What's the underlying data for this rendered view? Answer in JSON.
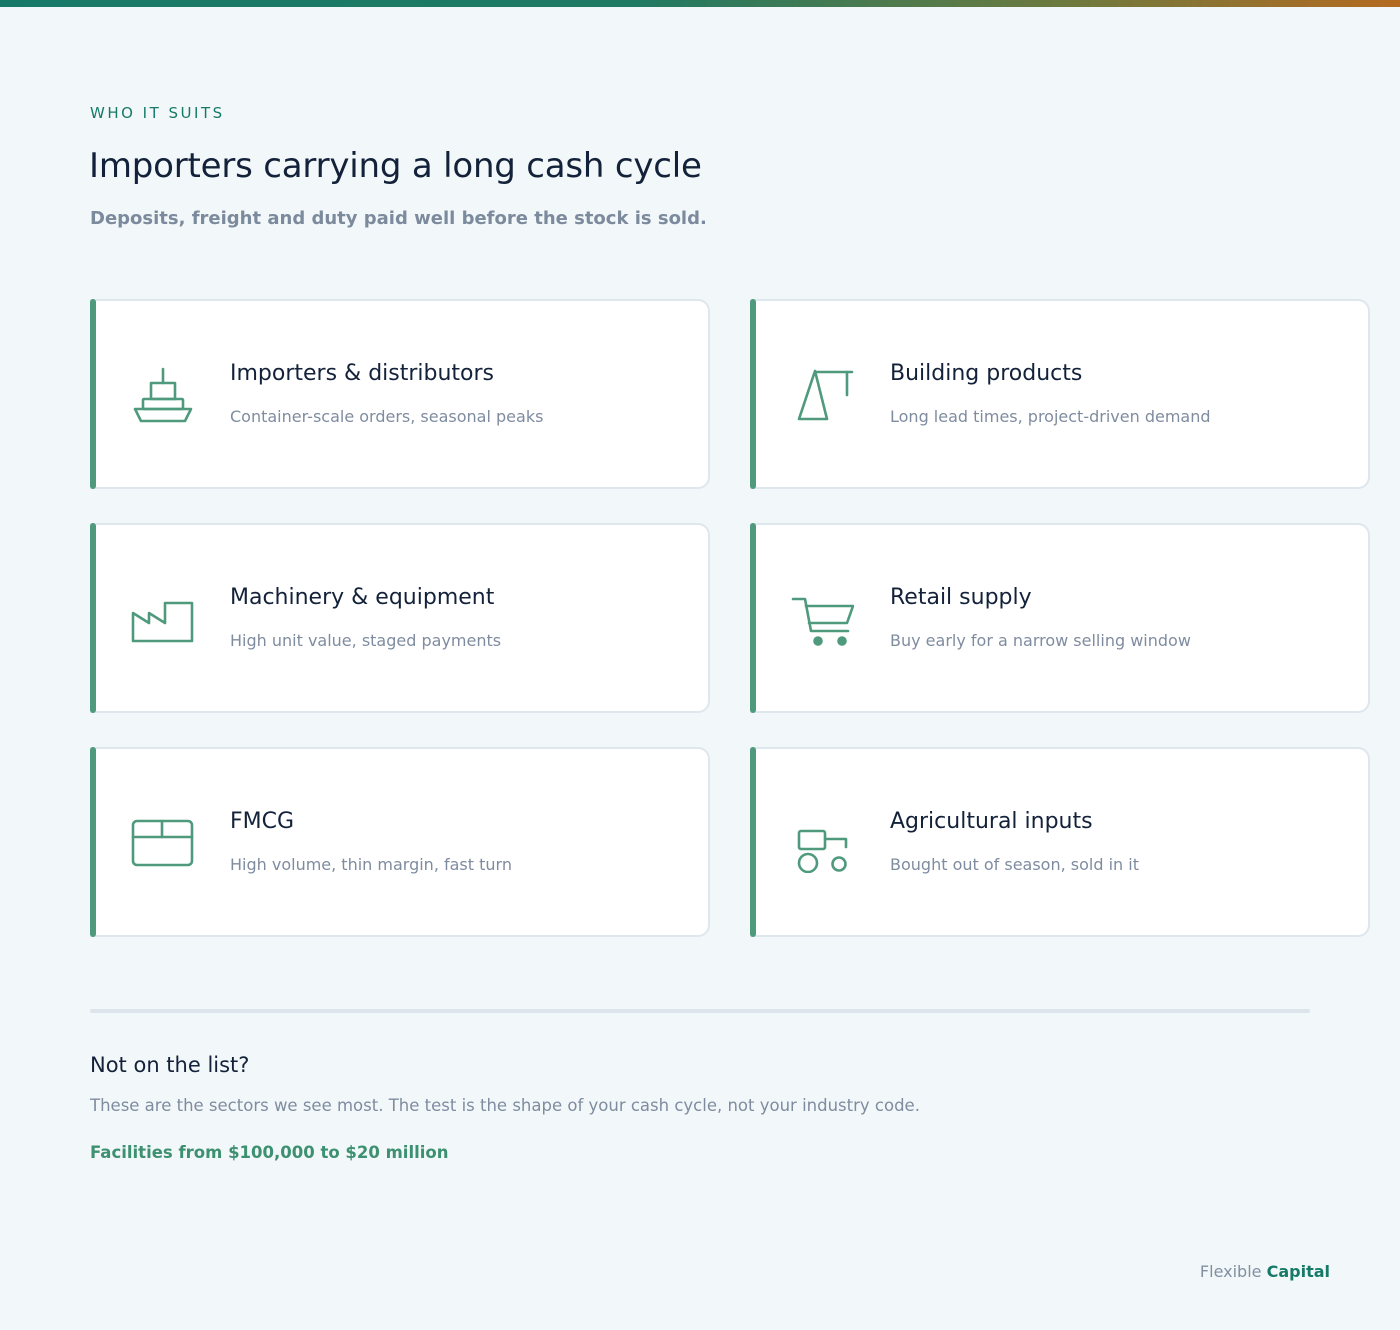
{
  "header": {
    "eyebrow": "WHO IT SUITS",
    "title": "Importers carrying a long cash cycle",
    "subtitle": "Deposits, freight and duty paid well before the stock is sold."
  },
  "sectors": [
    {
      "icon": "ship-icon",
      "title": "Importers & distributors",
      "desc": "Container-scale orders, seasonal peaks"
    },
    {
      "icon": "crane-icon",
      "title": "Building products",
      "desc": "Long lead times, project-driven demand"
    },
    {
      "icon": "factory-icon",
      "title": "Machinery & equipment",
      "desc": "High unit value, staged payments"
    },
    {
      "icon": "cart-icon",
      "title": "Retail supply",
      "desc": "Buy early for a narrow selling window"
    },
    {
      "icon": "box-icon",
      "title": "FMCG",
      "desc": "High volume, thin margin, fast turn"
    },
    {
      "icon": "tractor-icon",
      "title": "Agricultural inputs",
      "desc": "Bought out of season, sold in it"
    }
  ],
  "note": {
    "title": "Not on the list?",
    "text": "These are the sectors we see most. The test is the shape of your cash cycle, not your industry code.",
    "link": "Facilities from $100,000 to $20 million"
  },
  "brand": {
    "part1": "Flexible",
    "part2": "Capital"
  },
  "colors": {
    "accent": "#4f9a7d",
    "brand": "#177a68",
    "text": "#13223a",
    "muted": "#7f8ca0"
  }
}
